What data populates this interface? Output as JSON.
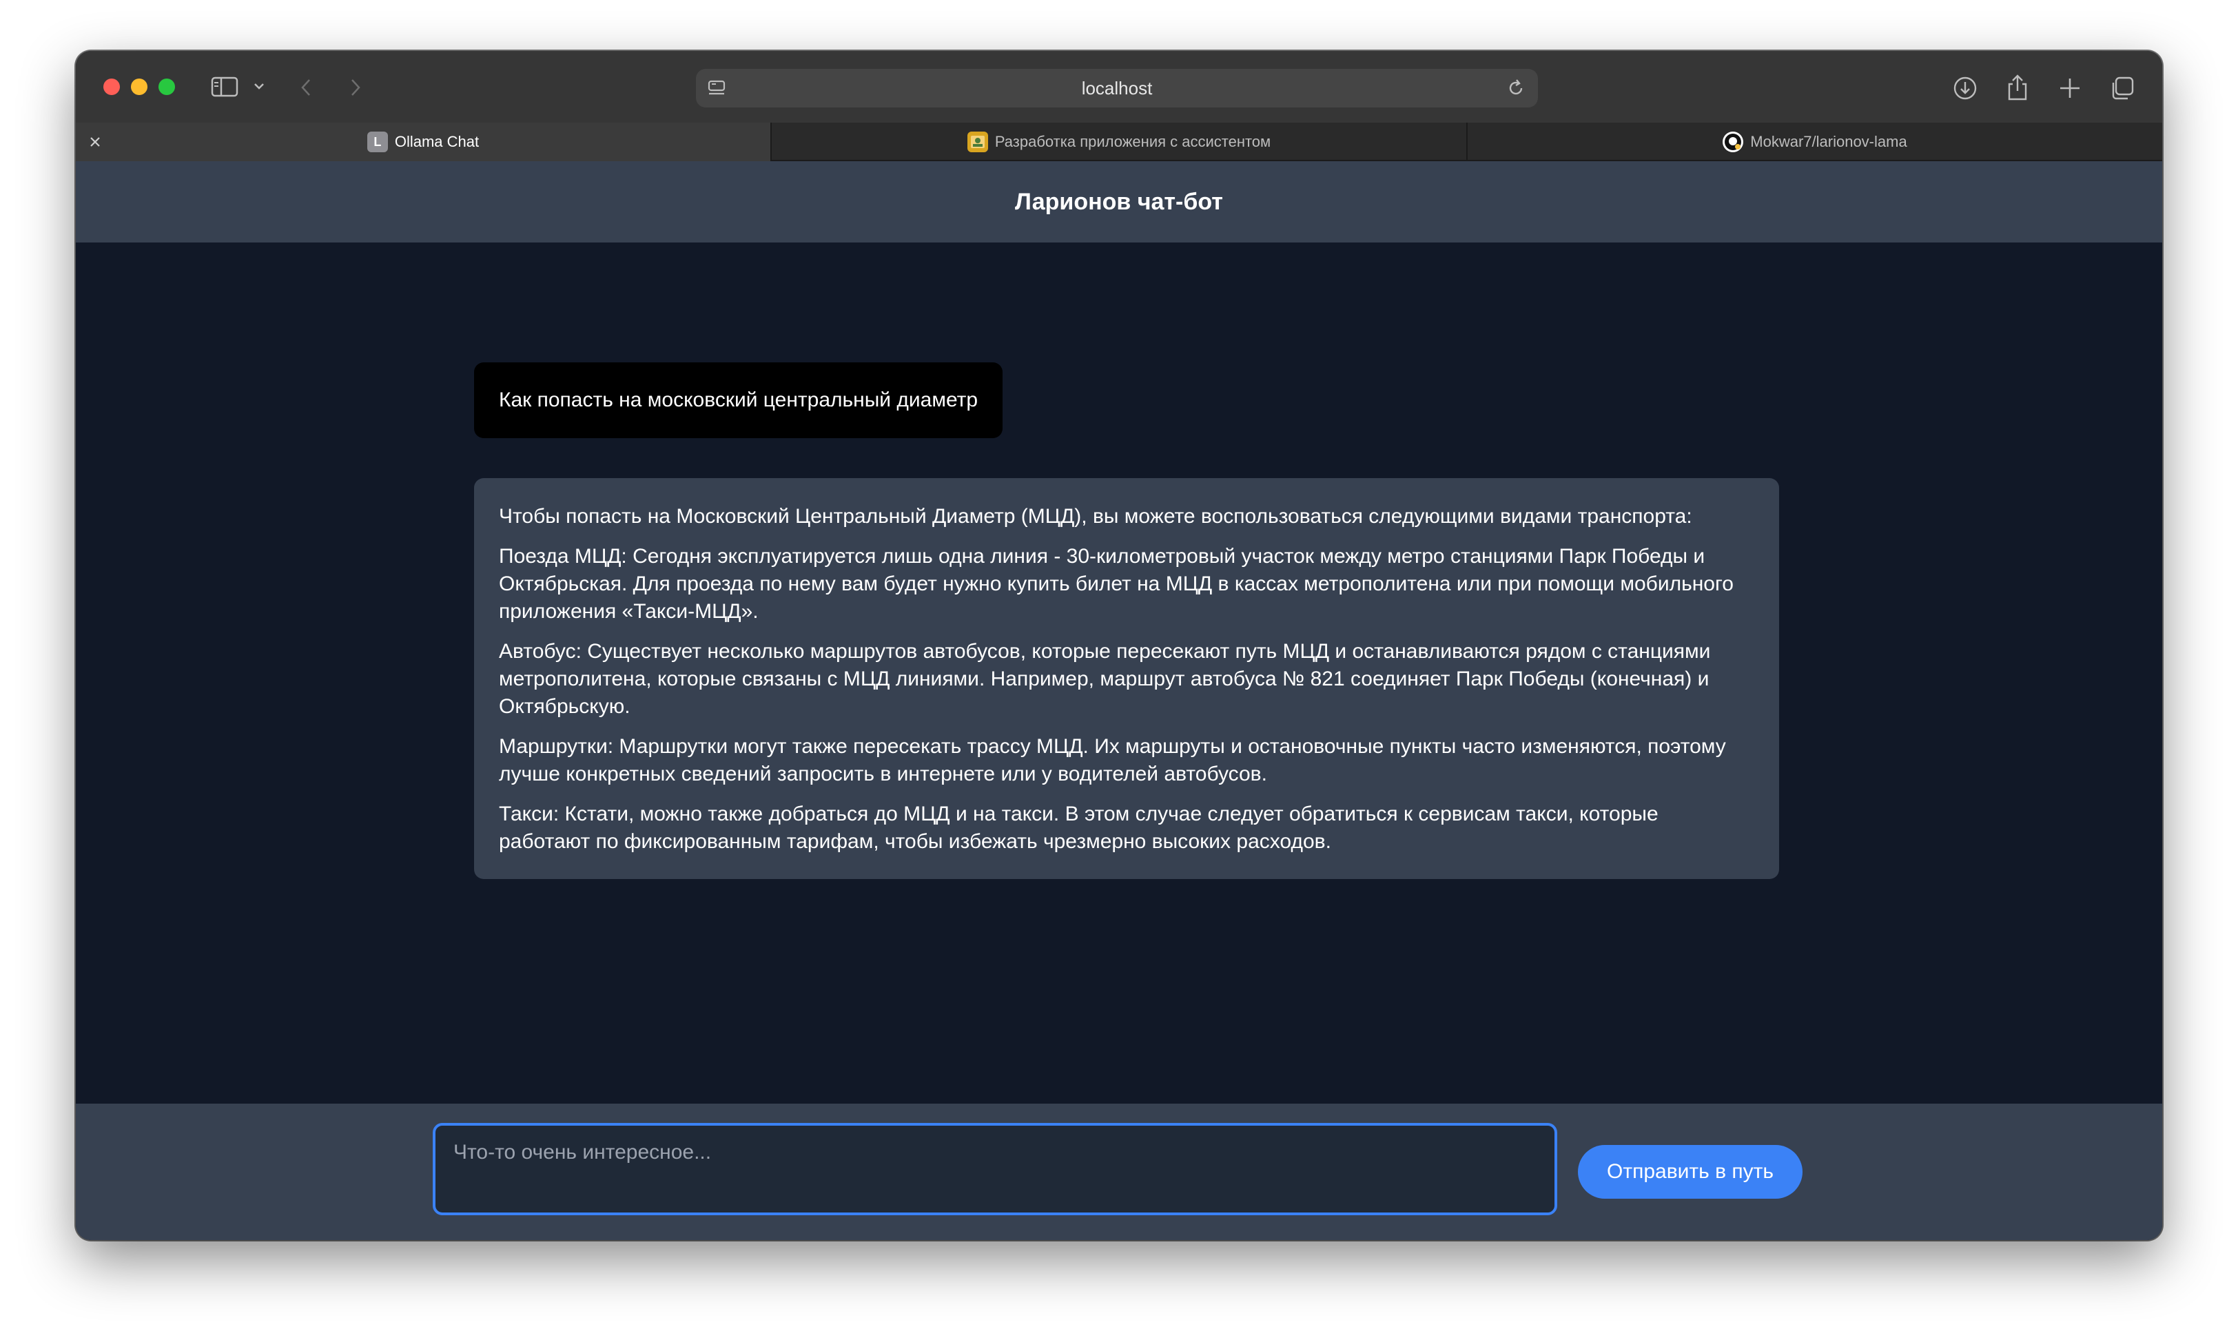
{
  "browser": {
    "address": "localhost",
    "tabs": [
      {
        "title": "Ollama Chat",
        "favicon": "L",
        "active": true
      },
      {
        "title": "Разработка приложения с ассистентом",
        "active": false
      },
      {
        "title": "Mokwar7/larionov-lama",
        "active": false
      }
    ]
  },
  "app": {
    "title": "Ларионов чат-бот",
    "messages": {
      "user": "Как попасть на московский центральный диаметр",
      "bot": [
        "Чтобы попасть на Московский Центральный Диаметр (МЦД), вы можете воспользоваться следующими видами транспорта:",
        "Поезда МЦД: Сегодня эксплуатируется лишь одна линия - 30-километровый участок между метро станциями Парк Победы и Октябрьская. Для проезда по нему вам будет нужно купить билет на МЦД в кассах метрополитена или при помощи мобильного приложения «Такси-МЦД».",
        "Автобус: Существует несколько маршрутов автобусов, которые пересекают путь МЦД и останавливаются рядом с станциями метрополитена, которые связаны с МЦД линиями. Например, маршрут автобуса № 821 соединяет Парк Победы (конечная) и Октябрьскую.",
        "Маршрутки: Маршрутки могут также пересекать трассу МЦД. Их маршруты и остановочные пункты часто изменяются, поэтому лучше конкретных сведений запросить в интернете или у водителей автобусов.",
        "Такси: Кстати, можно также добраться до МЦД и на такси. В этом случае следует обратиться к сервисам такси, которые работают по фиксированным тарифам, чтобы избежать чрезмерно высоких расходов."
      ]
    },
    "input": {
      "placeholder": "Что-то очень интересное...",
      "value": ""
    },
    "send_label": "Отправить в путь"
  },
  "colors": {
    "header_bg": "#374151",
    "chat_bg": "#111827",
    "accent": "#3b82f6",
    "user_bubble": "#000000"
  }
}
